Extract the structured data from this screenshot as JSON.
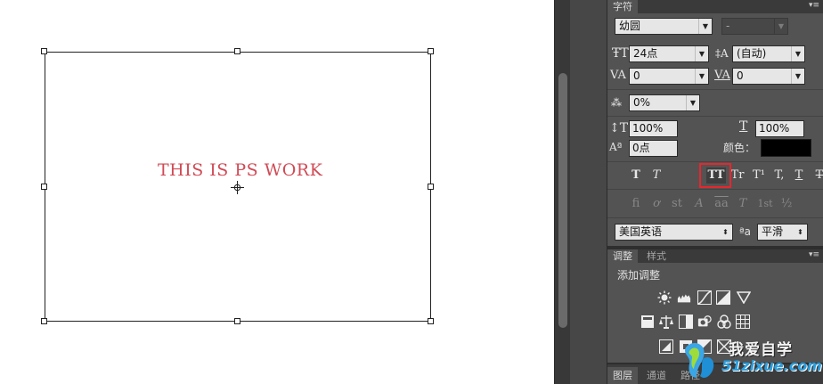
{
  "canvas": {
    "text": "THIS IS PS WORK",
    "text_color": "#d04a55"
  },
  "character_panel": {
    "tab": "字符",
    "font_family": "幼圆",
    "font_style": "-",
    "font_size": "24点",
    "leading": "(自动)",
    "kerning": "0",
    "tracking": "0",
    "tsume": "0%",
    "vertical_scale": "100%",
    "horizontal_scale": "100%",
    "baseline_shift": "0点",
    "color_label": "颜色：",
    "color_value": "#000000",
    "style_buttons": [
      "T",
      "T",
      "TT",
      "Tr",
      "T¹",
      "T,",
      "T",
      "T"
    ],
    "opentype_buttons": [
      "fi",
      "ơ",
      "st",
      "A",
      "aa",
      "T",
      "1st",
      "½"
    ],
    "language": "美国英语",
    "aa_icon": "ªa",
    "anti_alias": "平滑"
  },
  "adjustments_panel": {
    "tabs": [
      "调整",
      "样式"
    ],
    "title": "添加调整",
    "icons_row1": [
      "brightness-icon",
      "levels-icon",
      "curves-icon",
      "exposure-icon",
      "vibrance-icon"
    ],
    "icons_row2": [
      "hue-saturation-icon",
      "color-balance-icon",
      "black-white-icon",
      "photo-filter-icon",
      "channel-mixer-icon",
      "color-lookup-icon"
    ],
    "icons_row3": [
      "invert-icon",
      "posterize-icon",
      "threshold-icon",
      "gradient-map-icon"
    ]
  },
  "layers_tabs": [
    "图层",
    "通道",
    "路径"
  ],
  "watermark": {
    "top": "我爱自学",
    "bottom": "51zixue.com"
  },
  "colors": {
    "highlight": "#e8262d",
    "panel_bg": "#535353"
  }
}
